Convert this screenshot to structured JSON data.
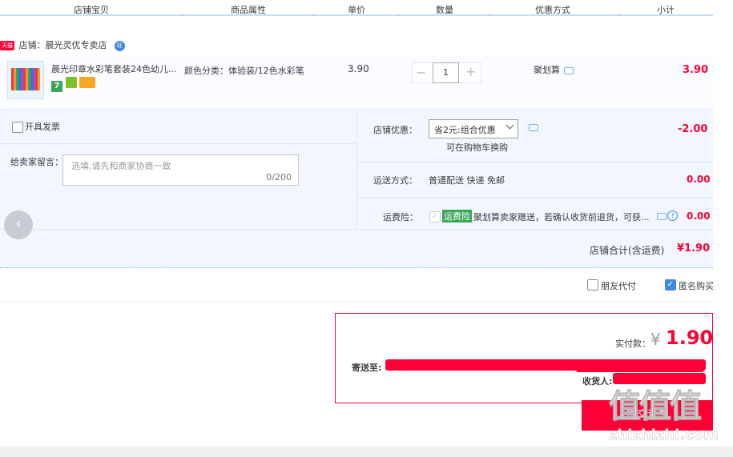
{
  "header": {
    "cols": [
      "店铺宝贝",
      "商品属性",
      "单价",
      "数量",
      "优惠方式",
      "小计"
    ]
  },
  "shop": {
    "badge": "天猫",
    "label": "店铺：",
    "name": "晨光灵优专卖店",
    "chat_badge": "旺"
  },
  "item": {
    "title": "晨光印章水彩笔套装24色幼儿...",
    "attr": "颜色分类：体验装/12色水彩笔",
    "price": "3.90",
    "qty": "1",
    "minus": "−",
    "plus": "+",
    "promo": "聚划算",
    "subtotal": "3.90",
    "tag7": "7"
  },
  "invoice": {
    "label": "开具发票"
  },
  "message": {
    "label": "给卖家留言：",
    "placeholder": "选填,请先和商家协商一致",
    "count": "0/200"
  },
  "shop_discount": {
    "label": "店铺优惠：",
    "selected": "省2元:组合优惠",
    "note": "可在购物车换购",
    "value": "-2.00"
  },
  "shipping": {
    "label": "运送方式：",
    "method": "普通配送 快递 免邮",
    "value": "0.00"
  },
  "insurance": {
    "label": "运费险：",
    "tag": "运费险",
    "desc": "聚划算卖家赠送，若确认收货前退货，可获...",
    "value": "0.00"
  },
  "shop_total": {
    "label": "店铺合计(含运费)",
    "value": "¥1.90"
  },
  "options": {
    "friend_pay": "朋友代付",
    "anonymous": "匿名购买"
  },
  "payment": {
    "label": "实付款：",
    "currency": "¥",
    "amount": "1.90",
    "ship_to": "寄送至:",
    "receiver": "收货人:"
  },
  "submit": {
    "label": "提交订单"
  },
  "watermark": {
    "big": "值值值",
    "site": "zhizhizhi.com"
  },
  "colors": {
    "accent": "#ff0036",
    "header_line": "#b2d1ff",
    "panel_bg": "#f2f7ff",
    "blue_link": "#3d8ae0"
  }
}
